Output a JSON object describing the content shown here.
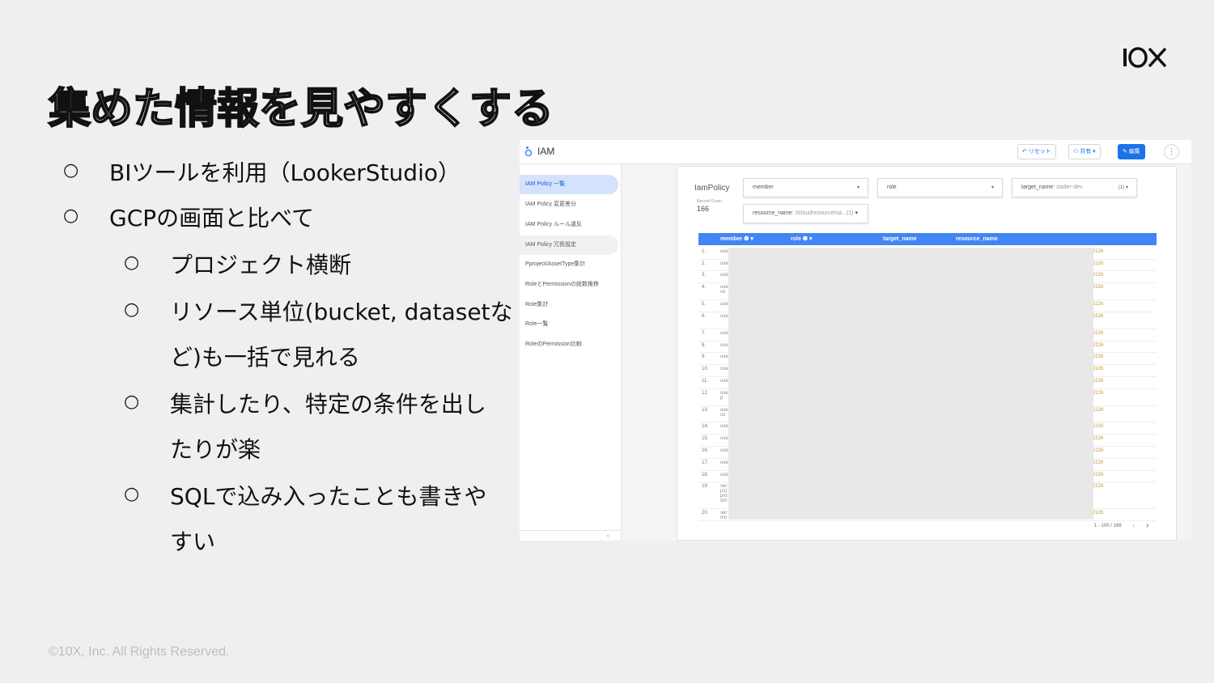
{
  "slide": {
    "title": "集めた情報を見やすくする",
    "logo_text": "10X",
    "footer": "©10X, Inc. All Rights Reserved.",
    "bullet_marker": "○",
    "bullets": [
      {
        "level": 1,
        "text": "BIツールを利用（LookerStudio）"
      },
      {
        "level": 1,
        "text": "GCPの画面と比べて"
      },
      {
        "level": 2,
        "text": "プロジェクト横断"
      },
      {
        "level": 2,
        "text": "リソース単位(bucket, datasetな"
      },
      {
        "level": 2,
        "text": "ど)も一括で見れる",
        "continuation": true
      },
      {
        "level": 2,
        "text": "集計したり、特定の条件を出し"
      },
      {
        "level": 2,
        "text": "たりが楽",
        "continuation": true
      },
      {
        "level": 2,
        "text": "SQLで込み入ったことも書きや"
      },
      {
        "level": 2,
        "text": "すい",
        "continuation": true
      }
    ]
  },
  "screenshot": {
    "app_title": "IAM",
    "toolbar": {
      "reset_label": "リセット",
      "share_label": "共有",
      "edit_label": "編集",
      "more_label": "⋮"
    },
    "sidebar": {
      "items": [
        {
          "label": "IAM Policy 一覧",
          "state": "active"
        },
        {
          "label": "IAM Policy 変更差分"
        },
        {
          "label": "IAM Policy ルール違反"
        },
        {
          "label": "IAM Policy 冗長設定",
          "state": "hover"
        },
        {
          "label": "Pproject/AssetType集計"
        },
        {
          "label": "RoleとPermissionの総数推移"
        },
        {
          "label": "Role集計"
        },
        {
          "label": "Role一覧"
        },
        {
          "label": "RoleのPermission比較"
        }
      ],
      "collapse_label": "‹"
    },
    "report": {
      "title": "IamPolicy",
      "record_count_label": "Record Count",
      "record_count": "166",
      "filters": [
        {
          "label": "member",
          "value": "",
          "count": ""
        },
        {
          "label": "role",
          "value": "",
          "count": ""
        },
        {
          "label": "target_name",
          "value": ": stailer-dev",
          "count": "(1)"
        },
        {
          "label": "resource_name",
          "value": ": //cloudresourcema...",
          "count": "(1)"
        }
      ],
      "columns": [
        "member ❶ ▾",
        "role ❶ ▾",
        "target_name",
        "resource_name"
      ],
      "rows": [
        {
          "num": "1.",
          "text": "use",
          "end": "2226"
        },
        {
          "num": "2.",
          "text": "use",
          "end": "2226"
        },
        {
          "num": "3.",
          "text": "use",
          "end": "2226"
        },
        {
          "num": "4.",
          "text": "use\nco",
          "end": "2226"
        },
        {
          "num": "5.",
          "text": "use",
          "end": "2226"
        },
        {
          "num": "6.",
          "text": "use",
          "end": "2226"
        },
        {
          "num": "7.",
          "text": "use",
          "end": "2226"
        },
        {
          "num": "8.",
          "text": "use",
          "end": "2226"
        },
        {
          "num": "9.",
          "text": "use",
          "end": "2226"
        },
        {
          "num": "10.",
          "text": "use",
          "end": "2226"
        },
        {
          "num": "11.",
          "text": "use",
          "end": "2226"
        },
        {
          "num": "12.",
          "text": "use\np",
          "end": "2226"
        },
        {
          "num": "13.",
          "text": "use\nco",
          "end": "2226"
        },
        {
          "num": "14.",
          "text": "use",
          "end": "2226"
        },
        {
          "num": "15.",
          "text": "use",
          "end": "2226"
        },
        {
          "num": "16.",
          "text": "use",
          "end": "2226"
        },
        {
          "num": "17.",
          "text": "use",
          "end": "2226"
        },
        {
          "num": "18.",
          "text": "use",
          "end": "2226"
        },
        {
          "num": "19.",
          "text": "ser\np1(\npro\nom",
          "end": "2226"
        },
        {
          "num": "20.",
          "text": "ser\nmo",
          "end": "2226"
        }
      ],
      "pagination": "1 - 100 / 166",
      "prev_label": "‹",
      "next_label": "›"
    }
  }
}
